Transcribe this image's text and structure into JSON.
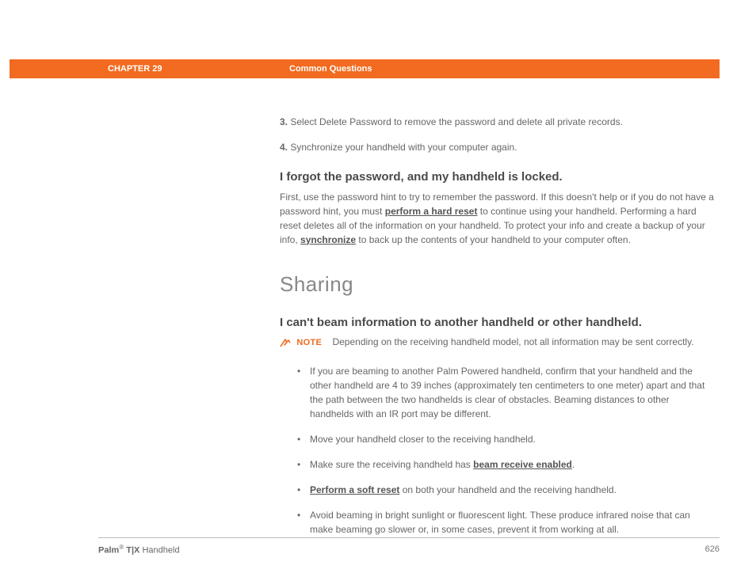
{
  "header": {
    "chapter": "CHAPTER 29",
    "section": "Common Questions"
  },
  "steps": {
    "s3num": "3.",
    "s3": "Select Delete Password to remove the password and delete all private records.",
    "s4num": "4.",
    "s4": "Synchronize your handheld with your computer again."
  },
  "forgot": {
    "heading": "I forgot the password, and my handheld is locked.",
    "p1a": "First, use the password hint to try to remember the password. If this doesn't help or if you do not have a password hint, you must ",
    "link1": "perform a hard reset",
    "p1b": " to continue using your handheld. Performing a hard reset deletes all of the information on your handheld. To protect your info and create a backup of your info, ",
    "link2": "synchronize",
    "p1c": " to back up the contents of your handheld to your computer often."
  },
  "sharing": {
    "heading": "Sharing",
    "sub": "I can't beam information to another handheld or other handheld.",
    "noteLabel": "NOTE",
    "noteText": "Depending on the receiving handheld model, not all information may be sent correctly.",
    "b1": "If you are beaming to another Palm Powered handheld, confirm that your handheld and the other handheld are 4 to 39 inches (approximately ten centimeters to one meter) apart and that the path between the two handhelds is clear of obstacles. Beaming distances to other handhelds with an IR port may be different.",
    "b2": "Move your handheld closer to the receiving handheld.",
    "b3a": "Make sure the receiving handheld has ",
    "b3link": "beam receive enabled",
    "b3b": ".",
    "b4link": "Perform a soft reset",
    "b4": " on both your handheld and the receiving handheld.",
    "b5": "Avoid beaming in bright sunlight or fluorescent light. These produce infrared noise that can make beaming go slower or, in some cases, prevent it from working at all."
  },
  "footer": {
    "brand": "Palm",
    "reg": "®",
    "model": " T|X",
    "type": " Handheld",
    "page": "626"
  }
}
